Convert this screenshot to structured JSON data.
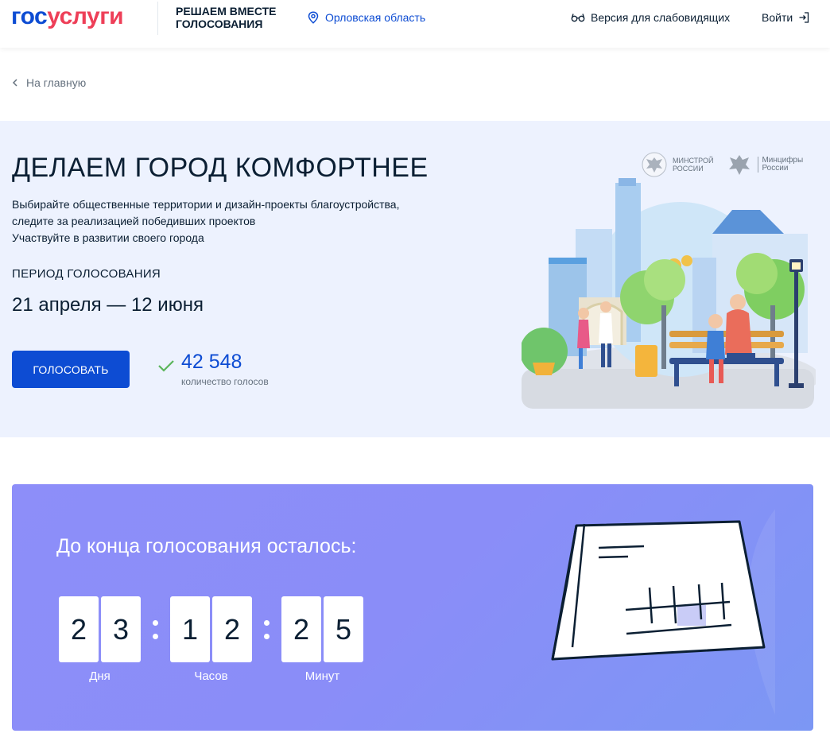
{
  "header": {
    "logo_part1": "гос",
    "logo_part2": "услуги",
    "project_line1": "РЕШАЕМ ВМЕСТЕ",
    "project_line2": "ГОЛОСОВАНИЯ",
    "region": "Орловская область",
    "accessibility": "Версия для слабовидящих",
    "login": "Войти"
  },
  "back_link": "На главную",
  "hero": {
    "title": "ДЕЛАЕМ ГОРОД КОМФОРТНЕЕ",
    "desc_line1": "Выбирайте общественные территории и дизайн-проекты благоустройства,",
    "desc_line2": "следите за реализацией победивших проектов",
    "desc_line3": "Участвуйте в развитии своего города",
    "period_label": "ПЕРИОД ГОЛОСОВАНИЯ",
    "period_value": "21 апреля — 12 июня",
    "vote_button": "ГОЛОСОВАТЬ",
    "votes_count": "42 548",
    "votes_label": "количество голосов",
    "partner1_line1": "МИНСТРОЙ",
    "partner1_line2": "РОССИИ",
    "partner2_line1": "Минцифры",
    "partner2_line2": "России"
  },
  "countdown": {
    "title": "До конца голосования осталось:",
    "days": [
      "2",
      "3"
    ],
    "hours": [
      "1",
      "2"
    ],
    "minutes": [
      "2",
      "5"
    ],
    "days_label": "Дня",
    "hours_label": "Часов",
    "minutes_label": "Минут"
  },
  "colors": {
    "brand_blue": "#0d4cd3",
    "brand_red": "#ee3f58",
    "hero_bg": "#edf2fe",
    "countdown_bg": "#8a8df8"
  },
  "icons": [
    "location-pin-icon",
    "glasses-icon",
    "login-arrow-icon",
    "chevron-left-icon",
    "checkmark-icon",
    "eagle-emblem-icon"
  ]
}
